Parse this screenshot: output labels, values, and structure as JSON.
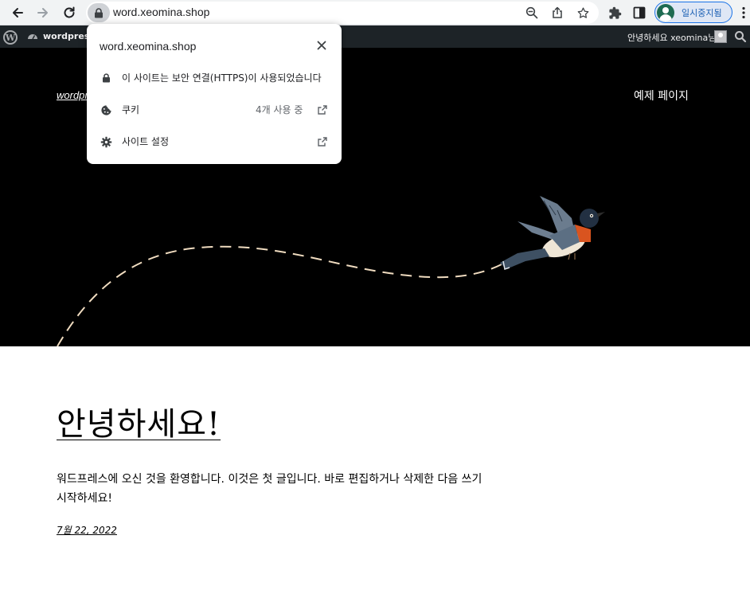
{
  "browser": {
    "url": "word.xeomina.shop",
    "profile_label": "일시중지됨",
    "colors": {
      "toolbar_bg": "#f1f3f4",
      "accent": "#1a73e8"
    }
  },
  "admin_bar": {
    "site_name": "wordpress",
    "greeting": "안녕하세요 xeomina님"
  },
  "site": {
    "title": "wordpress",
    "nav_link": "예제 페이지"
  },
  "site_info_popup": {
    "title": "word.xeomina.shop",
    "connection_text": "이 사이트는 보안 연결(HTTPS)이 사용되었습니다",
    "cookies_label": "쿠키",
    "cookies_count": "4개 사용 중",
    "site_settings_label": "사이트 설정"
  },
  "post": {
    "title": "안녕하세요!",
    "body": "워드프레스에 오신 것을 환영합니다. 이것은 첫 글입니다. 바로 편집하거나 삭제한 다음 쓰기 시작하세요!",
    "date": "7월 22, 2022"
  },
  "icons": [
    "back-arrow-icon",
    "forward-arrow-icon",
    "reload-icon",
    "lock-icon",
    "zoom-icon",
    "share-icon",
    "star-icon",
    "extensions-icon",
    "side-panel-icon",
    "more-vert-icon",
    "wordpress-logo-icon",
    "search-icon",
    "close-icon",
    "cookie-icon",
    "gear-icon",
    "external-link-icon"
  ]
}
